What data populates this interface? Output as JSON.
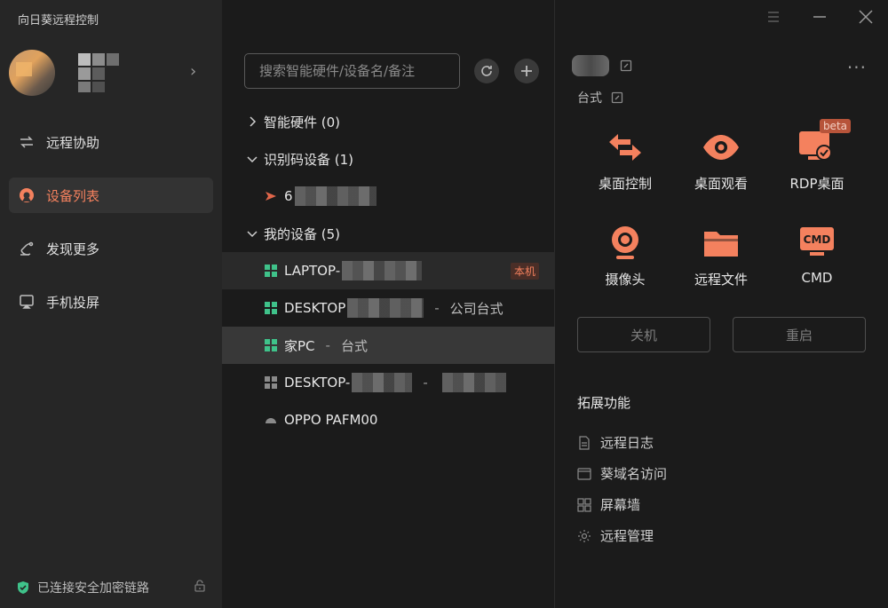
{
  "app": {
    "title": "向日葵远程控制"
  },
  "colors": {
    "accent": "#f4815e",
    "sidebar_bg": "#262626",
    "main_bg": "#1b1b1b",
    "selected_bg": "#383838",
    "online_green": "#3fc28a"
  },
  "sidebar": {
    "items": [
      {
        "label": "远程协助",
        "icon": "remote-assist-icon",
        "active": false
      },
      {
        "label": "设备列表",
        "icon": "device-list-icon",
        "active": true
      },
      {
        "label": "发现更多",
        "icon": "discover-icon",
        "active": false
      },
      {
        "label": "手机投屏",
        "icon": "cast-icon",
        "active": false
      }
    ],
    "security_text": "已连接安全加密链路"
  },
  "list": {
    "search_placeholder": "搜索智能硬件/设备名/备注",
    "groups": {
      "hardware": "智能硬件 (0)",
      "idcode": "识别码设备 (1)",
      "mine": "我的设备 (5)"
    },
    "idcode_device": {
      "name": "6"
    },
    "devices": [
      {
        "name": "LAPTOP-",
        "badge": "本机"
      },
      {
        "name": "DESKTOP",
        "sep": "-",
        "note": "公司台式"
      },
      {
        "name": "家PC",
        "sep": "-",
        "note": "台式"
      },
      {
        "name": "DESKTOP-",
        "sep": "-",
        "note": ""
      },
      {
        "name": "OPPO PAFM00"
      }
    ]
  },
  "detail": {
    "subtitle": "台式",
    "features": [
      {
        "label": "桌面控制",
        "icon": "desktop-control-icon"
      },
      {
        "label": "桌面观看",
        "icon": "desktop-view-icon"
      },
      {
        "label": "RDP桌面",
        "icon": "rdp-icon",
        "badge": "beta"
      },
      {
        "label": "摄像头",
        "icon": "camera-icon"
      },
      {
        "label": "远程文件",
        "icon": "folder-icon"
      },
      {
        "label": "CMD",
        "icon": "cmd-icon",
        "icon_text": "CMD"
      }
    ],
    "shutdown_label": "关机",
    "restart_label": "重启",
    "extensions_title": "拓展功能",
    "extensions": [
      {
        "label": "远程日志",
        "icon": "log-icon"
      },
      {
        "label": "葵域名访问",
        "icon": "domain-icon"
      },
      {
        "label": "屏幕墙",
        "icon": "screen-wall-icon"
      },
      {
        "label": "远程管理",
        "icon": "manage-icon"
      }
    ]
  }
}
